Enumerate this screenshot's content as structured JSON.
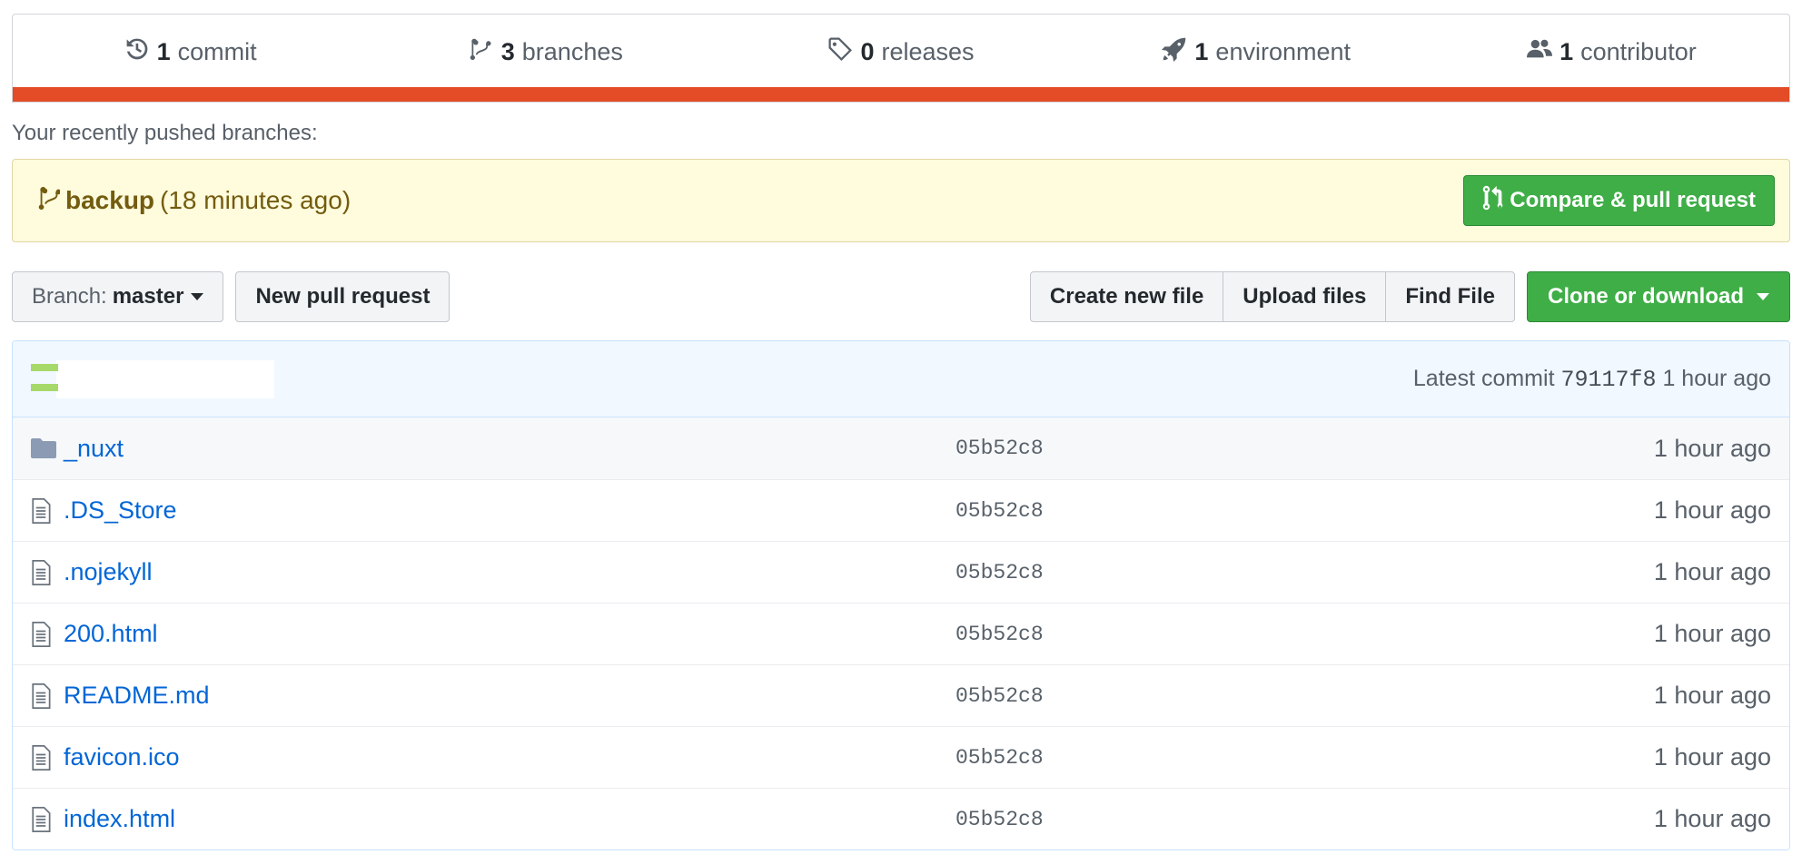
{
  "summary": {
    "commits": {
      "count": "1",
      "label": "commit",
      "icon": "history-icon"
    },
    "branches": {
      "count": "3",
      "label": "branches",
      "icon": "branch-icon"
    },
    "releases": {
      "count": "0",
      "label": "releases",
      "icon": "tag-icon"
    },
    "environments": {
      "count": "1",
      "label": "environment",
      "icon": "rocket-icon"
    },
    "contributors": {
      "count": "1",
      "label": "contributor",
      "icon": "people-icon"
    },
    "language_bar_color": "#e34c26"
  },
  "recent": {
    "label": "Your recently pushed branches:",
    "branch": "backup",
    "time": "(18 minutes ago)",
    "compare_button": "Compare & pull request"
  },
  "toolbar": {
    "branch_prefix": "Branch:",
    "branch_name": "master",
    "new_pr": "New pull request",
    "create_file": "Create new file",
    "upload_files": "Upload files",
    "find_file": "Find File",
    "clone": "Clone or download"
  },
  "latest_commit": {
    "prefix": "Latest commit",
    "sha": "79117f8",
    "time": "1 hour ago"
  },
  "files": [
    {
      "name": "_nuxt",
      "type": "folder",
      "sha": "05b52c8",
      "age": "1 hour ago"
    },
    {
      "name": ".DS_Store",
      "type": "file",
      "sha": "05b52c8",
      "age": "1 hour ago"
    },
    {
      "name": ".nojekyll",
      "type": "file",
      "sha": "05b52c8",
      "age": "1 hour ago"
    },
    {
      "name": "200.html",
      "type": "file",
      "sha": "05b52c8",
      "age": "1 hour ago"
    },
    {
      "name": "README.md",
      "type": "file",
      "sha": "05b52c8",
      "age": "1 hour ago"
    },
    {
      "name": "favicon.ico",
      "type": "file",
      "sha": "05b52c8",
      "age": "1 hour ago"
    },
    {
      "name": "index.html",
      "type": "file",
      "sha": "05b52c8",
      "age": "1 hour ago"
    }
  ],
  "colors": {
    "accent_green": "#3fae47",
    "link_blue": "#0366d6",
    "notice_bg": "#fffbdd"
  }
}
